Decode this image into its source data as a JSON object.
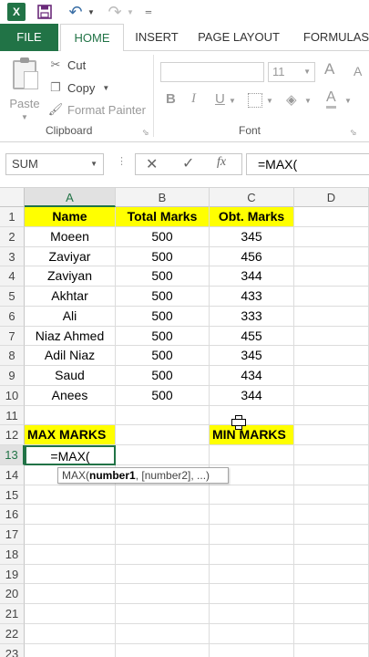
{
  "qat": {
    "app_icon": "excel-logo-icon",
    "app_letter": "X",
    "icons": [
      "save-icon",
      "undo-icon",
      "redo-icon",
      "customize-qat-icon"
    ]
  },
  "tabs": [
    "FILE",
    "HOME",
    "INSERT",
    "PAGE LAYOUT",
    "FORMULAS"
  ],
  "ribbon": {
    "paste": "Paste",
    "cut": "Cut",
    "copy": "Copy",
    "format_painter": "Format Painter",
    "clipboard": "Clipboard",
    "font_size": "11",
    "bold": "B",
    "italic": "I",
    "underline": "U",
    "grow_font": "A",
    "shrink_font": "A",
    "font_color": "A",
    "font": "Font"
  },
  "formula_bar": {
    "name_box": "SUM",
    "fx": "fx",
    "formula": "=MAX("
  },
  "columns": [
    "A",
    "B",
    "C",
    "D"
  ],
  "rows": [
    "1",
    "2",
    "3",
    "4",
    "5",
    "6",
    "7",
    "8",
    "9",
    "10",
    "11",
    "12",
    "13",
    "14",
    "15",
    "16",
    "17",
    "18",
    "19",
    "20",
    "21",
    "22",
    "23"
  ],
  "headers": {
    "name": "Name",
    "total": "Total Marks",
    "obt": "Obt. Marks"
  },
  "students": [
    {
      "name": "Moeen",
      "total": "500",
      "obt": "345"
    },
    {
      "name": "Zaviyar",
      "total": "500",
      "obt": "456"
    },
    {
      "name": "Zaviyan",
      "total": "500",
      "obt": "344"
    },
    {
      "name": "Akhtar",
      "total": "500",
      "obt": "433"
    },
    {
      "name": "Ali",
      "total": "500",
      "obt": "333"
    },
    {
      "name": "Niaz Ahmed",
      "total": "500",
      "obt": "455"
    },
    {
      "name": "Adil Niaz",
      "total": "500",
      "obt": "345"
    },
    {
      "name": "Saud",
      "total": "500",
      "obt": "434"
    },
    {
      "name": "Anees",
      "total": "500",
      "obt": "344"
    }
  ],
  "summary": {
    "max_label": "MAX MARKS",
    "min_label": "MIN MARKS"
  },
  "active_cell_text": "=MAX(",
  "tooltip": {
    "fn": "MAX(",
    "arg1": "number1",
    "rest": ", [number2], ...)"
  },
  "colors": {
    "accent": "#217346",
    "highlight": "#ffff00"
  }
}
